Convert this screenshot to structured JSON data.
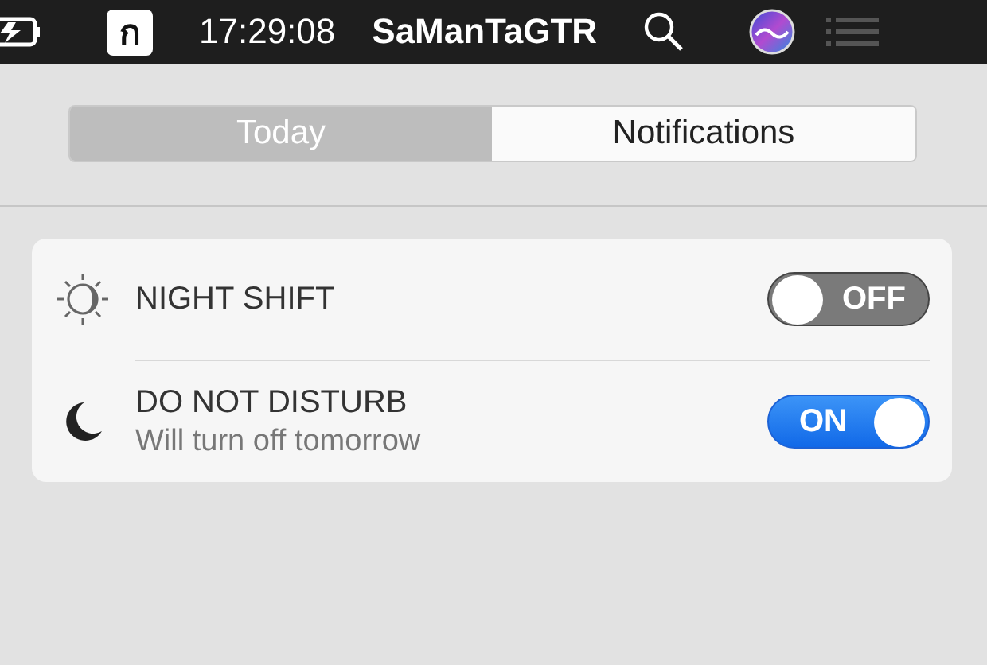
{
  "menu_bar": {
    "input_source": "ก",
    "clock": "17:29:08",
    "user": "SaManTaGTR"
  },
  "tabs": [
    {
      "label": "Today",
      "selected": true
    },
    {
      "label": "Notifications",
      "selected": false
    }
  ],
  "controls": [
    {
      "kind": "night-shift",
      "title": "NIGHT SHIFT",
      "on": false,
      "switch_label": "OFF"
    },
    {
      "kind": "do-not-disturb",
      "title": "DO NOT DISTURB",
      "subtitle": "Will turn off tomorrow",
      "on": true,
      "switch_label": "ON"
    }
  ]
}
